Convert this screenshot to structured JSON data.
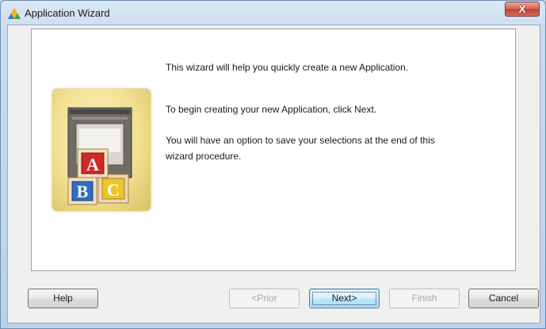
{
  "window": {
    "title": "Application Wizard",
    "close_glyph": "X",
    "icon": "triangle-app-icon"
  },
  "content": {
    "intro": "This wizard will help you quickly create a new Application.",
    "begin": "To begin creating your new Application, click Next.",
    "save_note": "You will have an option to save your selections at the end of this wizard procedure.",
    "illustration": {
      "icon": "abc-blocks-illustration",
      "letters": [
        "A",
        "B",
        "C"
      ]
    }
  },
  "buttons": {
    "help": "Help",
    "prior": "<Prior",
    "next": "Next>",
    "finish": "Finish",
    "cancel": "Cancel"
  },
  "state": {
    "prior_enabled": false,
    "finish_enabled": false,
    "default_button": "next"
  }
}
